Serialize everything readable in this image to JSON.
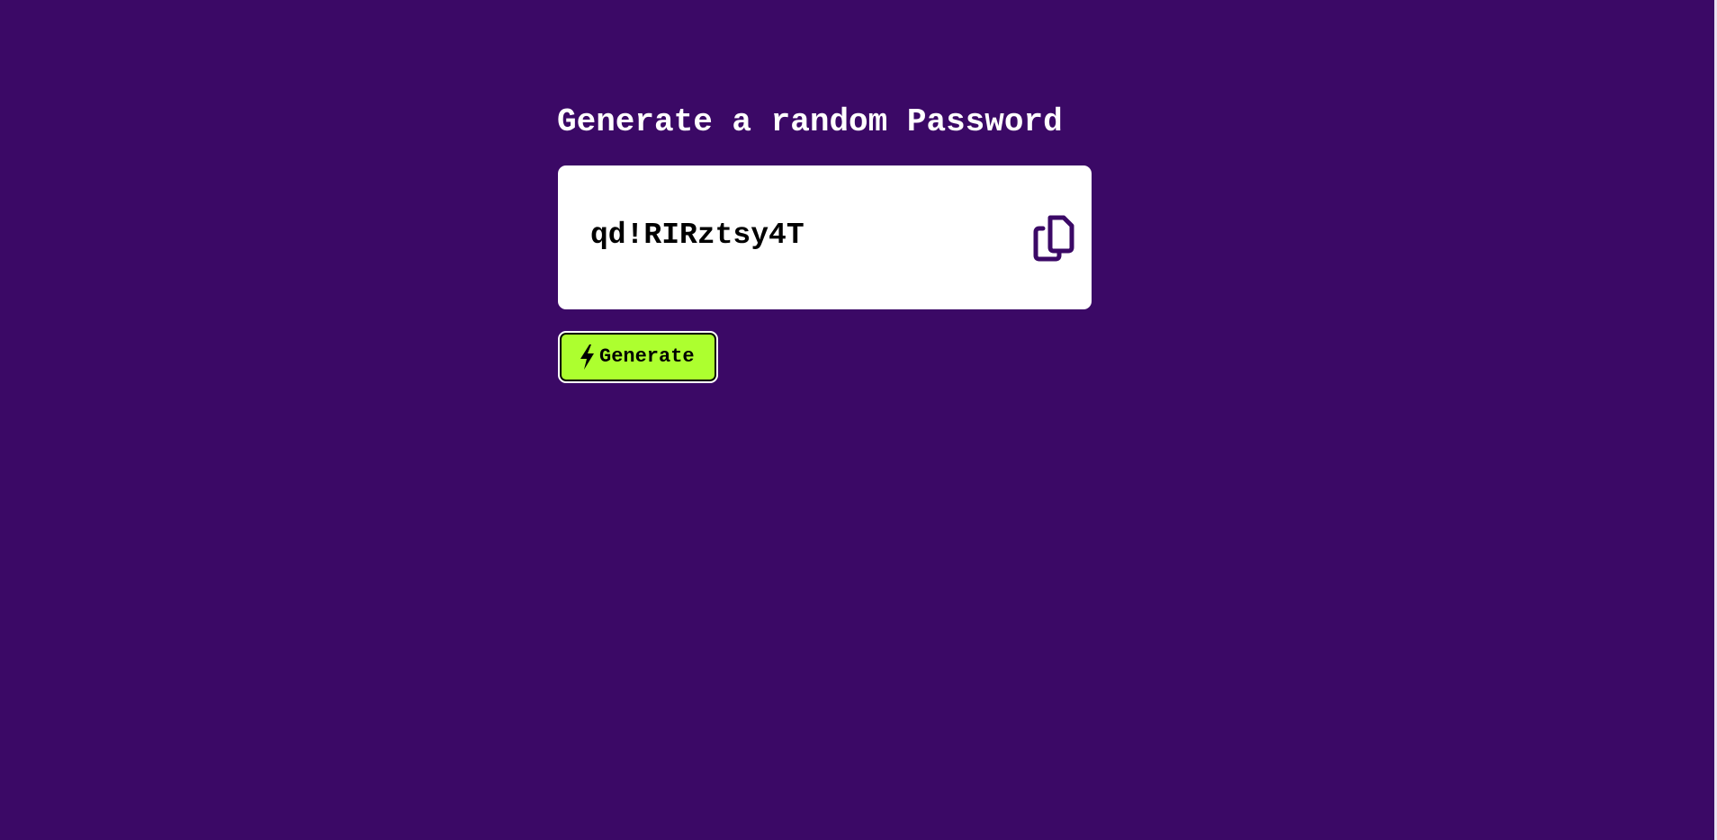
{
  "page": {
    "title": "Generate a random Password",
    "background_color": "#3b0966"
  },
  "password_card": {
    "password": "qd!RIRztsy4T",
    "copy_icon": "copy-icon",
    "copy_icon_color": "#3b0966"
  },
  "generate_button": {
    "label": "Generate",
    "icon": "lightning-bolt-icon",
    "background_color": "#adff2f"
  }
}
